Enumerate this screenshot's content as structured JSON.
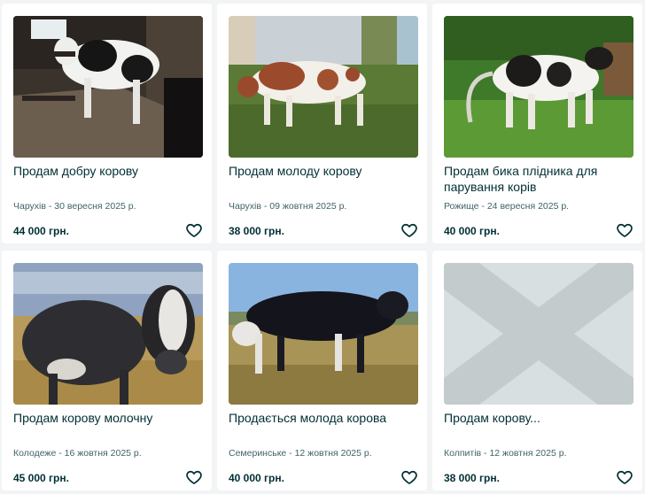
{
  "listings": [
    {
      "title": "Продам добру корову",
      "location_date": "Чарухів - 30 вересня 2025 р.",
      "price": "44 000 грн.",
      "photo": "cow-in-barn-night",
      "favorite_icon": "heart-outline-icon"
    },
    {
      "title": "Продам молоду корову",
      "location_date": "Чарухів - 09 жовтня 2025 р.",
      "price": "38 000 грн.",
      "photo": "red-white-cow-yard",
      "favorite_icon": "heart-outline-icon"
    },
    {
      "title": "Продам бика плідника для парування корів",
      "location_date": "Рожище - 24 вересня 2025 р.",
      "price": "40 000 грн.",
      "photo": "bull-in-garden",
      "favorite_icon": "heart-outline-icon"
    },
    {
      "title": "Продам корову молочну",
      "location_date": "Колодеже - 16 жовтня 2025 р.",
      "price": "45 000 грн.",
      "photo": "black-cow-closeup",
      "favorite_icon": "heart-outline-icon"
    },
    {
      "title": "Продається молода корова",
      "location_date": "Семеринське - 12 жовтня 2025 р.",
      "price": "40 000 грн.",
      "photo": "black-cow-field",
      "favorite_icon": "heart-outline-icon"
    },
    {
      "title": "Продам корову...",
      "location_date": "Колпитів - 12 жовтня 2025 р.",
      "price": "38 000 грн.",
      "photo": "no-photo-placeholder",
      "favorite_icon": "heart-outline-icon"
    }
  ],
  "colors": {
    "background": "#f2f4f5",
    "card": "#ffffff",
    "text": "#002f34",
    "meta": "#406367",
    "placeholder": "#d8dfe0"
  }
}
